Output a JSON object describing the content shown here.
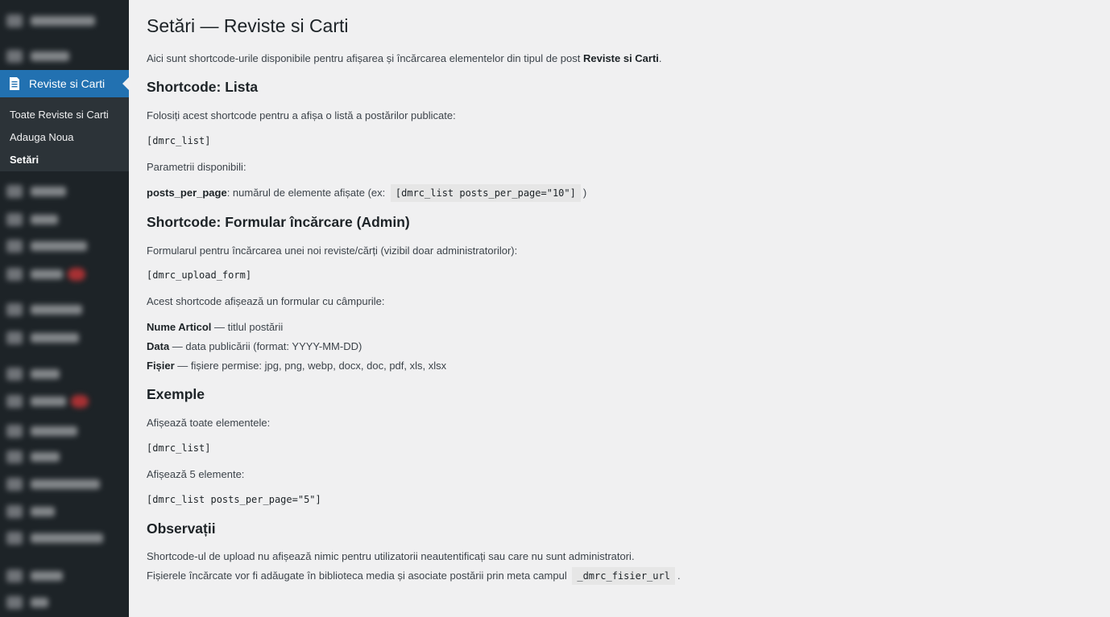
{
  "sidebar": {
    "active_menu": {
      "label": "Reviste si Carti",
      "icon": "document-icon"
    },
    "submenu": [
      {
        "label": "Toate Reviste si Carti"
      },
      {
        "label": "Adauga Noua"
      },
      {
        "label": "Setări"
      }
    ]
  },
  "page": {
    "title": "Setări — Reviste si Carti",
    "intro_text": "Aici sunt shortcode-urile disponibile pentru afișarea și încărcarea elementelor din tipul de post",
    "intro_bold": "Reviste si Carti",
    "intro_end": ".",
    "list_section": {
      "heading": "Shortcode: Lista",
      "desc": "Folosiți acest shortcode pentru a afișa o listă a postărilor publicate:",
      "code": "[dmrc_list]",
      "params_label": "Parametrii disponibili:",
      "param_name": "posts_per_page",
      "param_desc": ": numărul de elemente afișate (ex:",
      "param_example": "[dmrc_list posts_per_page=\"10\"]",
      "param_end": ")"
    },
    "form_section": {
      "heading": "Shortcode: Formular încărcare (Admin)",
      "desc": "Formularul pentru încărcarea unei noi reviste/cărți (vizibil doar administratorilor):",
      "code": "[dmrc_upload_form]",
      "fields_intro": "Acest shortcode afișează un formular cu câmpurile:",
      "fields": [
        {
          "name": "Nume Articol",
          "desc": " — titlul postării"
        },
        {
          "name": "Data",
          "desc": " — data publicării (format: YYYY-MM-DD)"
        },
        {
          "name": "Fișier",
          "desc": " — fișiere permise: jpg, png, webp, docx, doc, pdf, xls, xlsx"
        }
      ]
    },
    "examples_section": {
      "heading": "Exemple",
      "ex1_desc": "Afișează toate elementele:",
      "ex1_code": "[dmrc_list]",
      "ex2_desc": "Afișează 5 elemente:",
      "ex2_code": "[dmrc_list posts_per_page=\"5\"]"
    },
    "notes_section": {
      "heading": "Observații",
      "note1": "Shortcode-ul de upload nu afișează nimic pentru utilizatorii neautentificați sau care nu sunt administratori.",
      "note2": "Fișierele încărcate vor fi adăugate în biblioteca media și asociate postării prin meta campul",
      "note2_code": "_dmrc_fisier_url",
      "note2_end": "."
    }
  },
  "colors": {
    "sidebar_bg": "#1d2327",
    "submenu_bg": "#2c3338",
    "active_bg": "#2271b1",
    "content_bg": "#f0f0f1",
    "badge": "#d63638"
  }
}
